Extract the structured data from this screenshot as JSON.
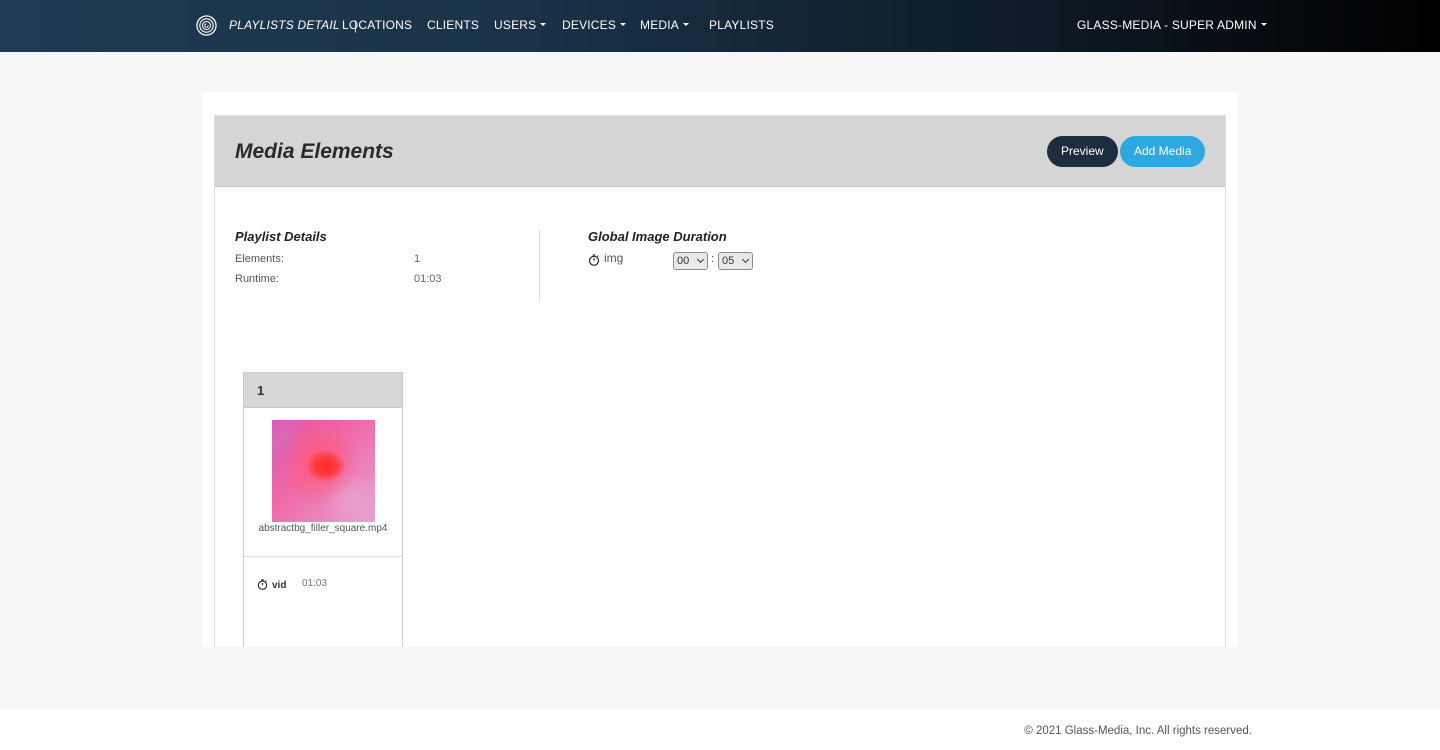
{
  "nav": {
    "brand_title": "PLAYLISTS DETAIL",
    "separator": "|",
    "items": [
      {
        "label": "LOCATIONS",
        "caret": false
      },
      {
        "label": "CLIENTS",
        "caret": false
      },
      {
        "label": "USERS",
        "caret": true
      },
      {
        "label": "DEVICES",
        "caret": true
      },
      {
        "label": "MEDIA",
        "caret": true
      },
      {
        "label": "PLAYLISTS",
        "caret": false
      }
    ],
    "account_label": "GLASS-MEDIA - SUPER ADMIN"
  },
  "panel": {
    "title": "Media Elements",
    "preview_button": "Preview",
    "add_media_button": "Add Media"
  },
  "details": {
    "title": "Playlist Details",
    "elements_label": "Elements:",
    "elements_value": "1",
    "runtime_label": "Runtime:",
    "runtime_value": "01:03"
  },
  "global_duration": {
    "title": "Global Image Duration",
    "type_label": "img",
    "minutes": "00",
    "separator": ":",
    "seconds": "05"
  },
  "media_items": [
    {
      "index": "1",
      "filename": "abstractbg_filler_square.mp4",
      "type": "vid",
      "duration": "01:03"
    }
  ],
  "footer": {
    "copyright": "© 2021 Glass-Media, Inc. All rights reserved."
  },
  "colors": {
    "nav_start": "#1f3a52",
    "nav_end": "#000000",
    "preview_button": "#1e2d3d",
    "add_media_button": "#2ea8e0",
    "panel_header": "#d5d5d5"
  }
}
